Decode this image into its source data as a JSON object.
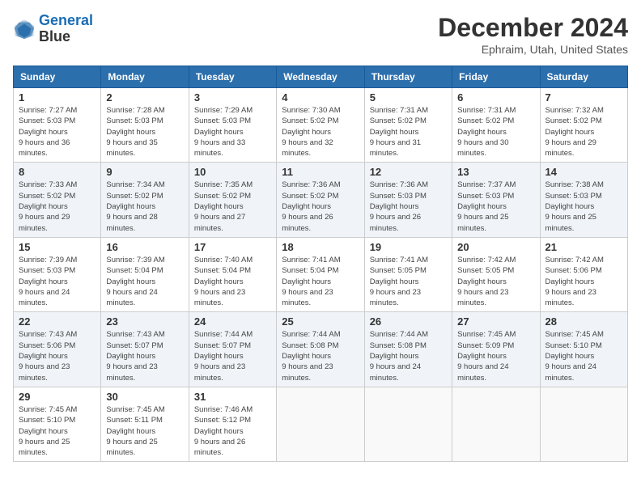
{
  "header": {
    "logo_line1": "General",
    "logo_line2": "Blue",
    "month_title": "December 2024",
    "location": "Ephraim, Utah, United States"
  },
  "days_of_week": [
    "Sunday",
    "Monday",
    "Tuesday",
    "Wednesday",
    "Thursday",
    "Friday",
    "Saturday"
  ],
  "weeks": [
    [
      {
        "day": "1",
        "sunrise": "7:27 AM",
        "sunset": "5:03 PM",
        "daylight": "9 hours and 36 minutes."
      },
      {
        "day": "2",
        "sunrise": "7:28 AM",
        "sunset": "5:03 PM",
        "daylight": "9 hours and 35 minutes."
      },
      {
        "day": "3",
        "sunrise": "7:29 AM",
        "sunset": "5:03 PM",
        "daylight": "9 hours and 33 minutes."
      },
      {
        "day": "4",
        "sunrise": "7:30 AM",
        "sunset": "5:02 PM",
        "daylight": "9 hours and 32 minutes."
      },
      {
        "day": "5",
        "sunrise": "7:31 AM",
        "sunset": "5:02 PM",
        "daylight": "9 hours and 31 minutes."
      },
      {
        "day": "6",
        "sunrise": "7:31 AM",
        "sunset": "5:02 PM",
        "daylight": "9 hours and 30 minutes."
      },
      {
        "day": "7",
        "sunrise": "7:32 AM",
        "sunset": "5:02 PM",
        "daylight": "9 hours and 29 minutes."
      }
    ],
    [
      {
        "day": "8",
        "sunrise": "7:33 AM",
        "sunset": "5:02 PM",
        "daylight": "9 hours and 29 minutes."
      },
      {
        "day": "9",
        "sunrise": "7:34 AM",
        "sunset": "5:02 PM",
        "daylight": "9 hours and 28 minutes."
      },
      {
        "day": "10",
        "sunrise": "7:35 AM",
        "sunset": "5:02 PM",
        "daylight": "9 hours and 27 minutes."
      },
      {
        "day": "11",
        "sunrise": "7:36 AM",
        "sunset": "5:02 PM",
        "daylight": "9 hours and 26 minutes."
      },
      {
        "day": "12",
        "sunrise": "7:36 AM",
        "sunset": "5:03 PM",
        "daylight": "9 hours and 26 minutes."
      },
      {
        "day": "13",
        "sunrise": "7:37 AM",
        "sunset": "5:03 PM",
        "daylight": "9 hours and 25 minutes."
      },
      {
        "day": "14",
        "sunrise": "7:38 AM",
        "sunset": "5:03 PM",
        "daylight": "9 hours and 25 minutes."
      }
    ],
    [
      {
        "day": "15",
        "sunrise": "7:39 AM",
        "sunset": "5:03 PM",
        "daylight": "9 hours and 24 minutes."
      },
      {
        "day": "16",
        "sunrise": "7:39 AM",
        "sunset": "5:04 PM",
        "daylight": "9 hours and 24 minutes."
      },
      {
        "day": "17",
        "sunrise": "7:40 AM",
        "sunset": "5:04 PM",
        "daylight": "9 hours and 23 minutes."
      },
      {
        "day": "18",
        "sunrise": "7:41 AM",
        "sunset": "5:04 PM",
        "daylight": "9 hours and 23 minutes."
      },
      {
        "day": "19",
        "sunrise": "7:41 AM",
        "sunset": "5:05 PM",
        "daylight": "9 hours and 23 minutes."
      },
      {
        "day": "20",
        "sunrise": "7:42 AM",
        "sunset": "5:05 PM",
        "daylight": "9 hours and 23 minutes."
      },
      {
        "day": "21",
        "sunrise": "7:42 AM",
        "sunset": "5:06 PM",
        "daylight": "9 hours and 23 minutes."
      }
    ],
    [
      {
        "day": "22",
        "sunrise": "7:43 AM",
        "sunset": "5:06 PM",
        "daylight": "9 hours and 23 minutes."
      },
      {
        "day": "23",
        "sunrise": "7:43 AM",
        "sunset": "5:07 PM",
        "daylight": "9 hours and 23 minutes."
      },
      {
        "day": "24",
        "sunrise": "7:44 AM",
        "sunset": "5:07 PM",
        "daylight": "9 hours and 23 minutes."
      },
      {
        "day": "25",
        "sunrise": "7:44 AM",
        "sunset": "5:08 PM",
        "daylight": "9 hours and 23 minutes."
      },
      {
        "day": "26",
        "sunrise": "7:44 AM",
        "sunset": "5:08 PM",
        "daylight": "9 hours and 24 minutes."
      },
      {
        "day": "27",
        "sunrise": "7:45 AM",
        "sunset": "5:09 PM",
        "daylight": "9 hours and 24 minutes."
      },
      {
        "day": "28",
        "sunrise": "7:45 AM",
        "sunset": "5:10 PM",
        "daylight": "9 hours and 24 minutes."
      }
    ],
    [
      {
        "day": "29",
        "sunrise": "7:45 AM",
        "sunset": "5:10 PM",
        "daylight": "9 hours and 25 minutes."
      },
      {
        "day": "30",
        "sunrise": "7:45 AM",
        "sunset": "5:11 PM",
        "daylight": "9 hours and 25 minutes."
      },
      {
        "day": "31",
        "sunrise": "7:46 AM",
        "sunset": "5:12 PM",
        "daylight": "9 hours and 26 minutes."
      },
      null,
      null,
      null,
      null
    ]
  ]
}
